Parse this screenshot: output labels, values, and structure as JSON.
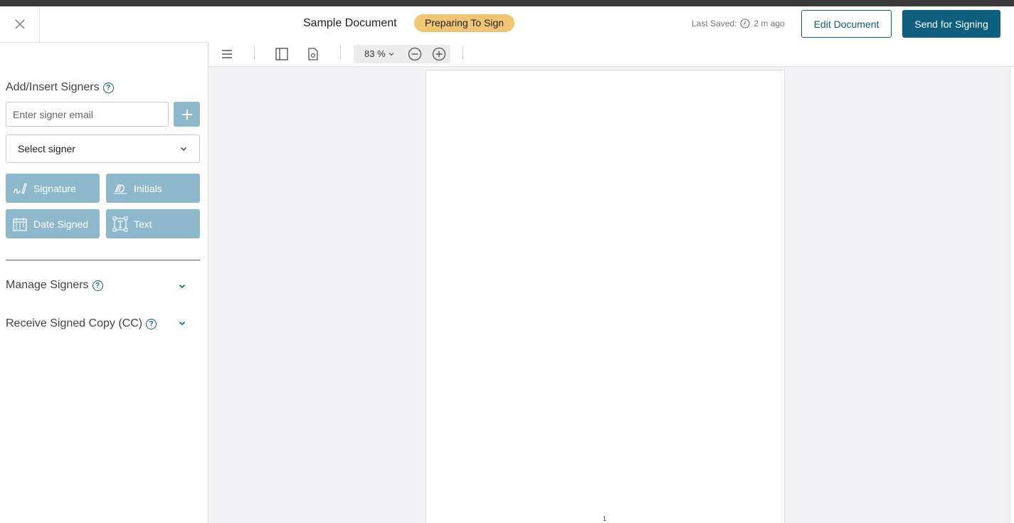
{
  "header": {
    "title": "Sample Document",
    "status": "Preparing To Sign",
    "last_saved_label": "Last Saved:",
    "last_saved_value": "2 m ago",
    "edit_label": "Edit Document",
    "send_label": "Send for Signing"
  },
  "sidebar": {
    "add_signers_heading": "Add/Insert Signers",
    "email_placeholder": "Enter signer email",
    "select_signer": "Select signer",
    "fields": {
      "signature": "Signature",
      "initials": "Initials",
      "date_signed": "Date Signed",
      "text": "Text"
    },
    "manage_signers": "Manage Signers",
    "receive_copy": "Receive Signed Copy (CC)"
  },
  "toolbar": {
    "zoom": "83 %"
  },
  "viewer": {
    "page_number": "1"
  },
  "colors": {
    "brand": "#0e5f7d",
    "field_button": "#8db8cb",
    "status_badge": "#f0c674"
  },
  "icons": [
    "close-icon",
    "help-icon",
    "plus-icon",
    "chevron-down-icon",
    "signature-icon",
    "initials-icon",
    "calendar-icon",
    "text-field-icon",
    "menu-icon",
    "sidebar-toggle-icon",
    "document-settings-icon",
    "zoom-out-icon",
    "zoom-in-icon",
    "clock-icon"
  ]
}
